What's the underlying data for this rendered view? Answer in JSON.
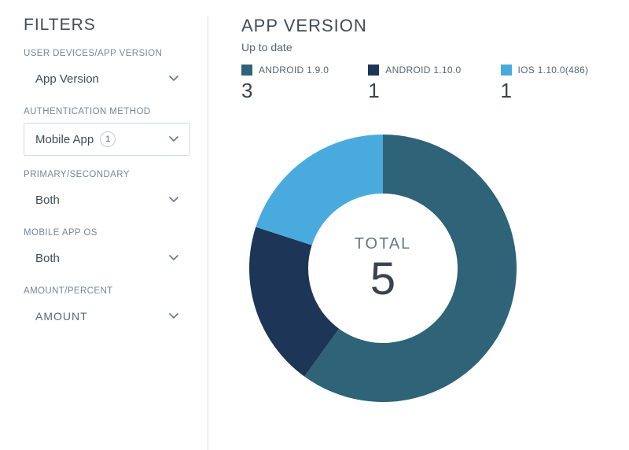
{
  "sidebar": {
    "title": "FILTERS",
    "filters": [
      {
        "label": "USER DEVICES/APP VERSION",
        "value": "App Version",
        "bordered": false,
        "badge": null
      },
      {
        "label": "AUTHENTICATION METHOD",
        "value": "Mobile App",
        "bordered": true,
        "badge": "1"
      },
      {
        "label": "PRIMARY/SECONDARY",
        "value": "Both",
        "bordered": false,
        "badge": null
      },
      {
        "label": "MOBILE APP OS",
        "value": "Both",
        "bordered": false,
        "badge": null
      },
      {
        "label": "AMOUNT/PERCENT",
        "value": "AMOUNT",
        "bordered": false,
        "badge": null,
        "caps": true
      }
    ]
  },
  "chart": {
    "title": "APP VERSION",
    "subtitle": "Up to date",
    "total_label": "TOTAL",
    "total_value": "5"
  },
  "colors": {
    "teal": "#2e6378",
    "navy": "#1d3556",
    "sky": "#49abdd"
  },
  "chart_data": {
    "type": "pie",
    "title": "APP VERSION",
    "subtitle": "Up to date",
    "series": [
      {
        "name": "ANDROID 1.9.0",
        "value": 3,
        "color": "#2e6378"
      },
      {
        "name": "ANDROID 1.10.0",
        "value": 1,
        "color": "#1d3556"
      },
      {
        "name": "IOS 1.10.0(486)",
        "value": 1,
        "color": "#49abdd"
      }
    ],
    "total": 5,
    "donut": true
  }
}
